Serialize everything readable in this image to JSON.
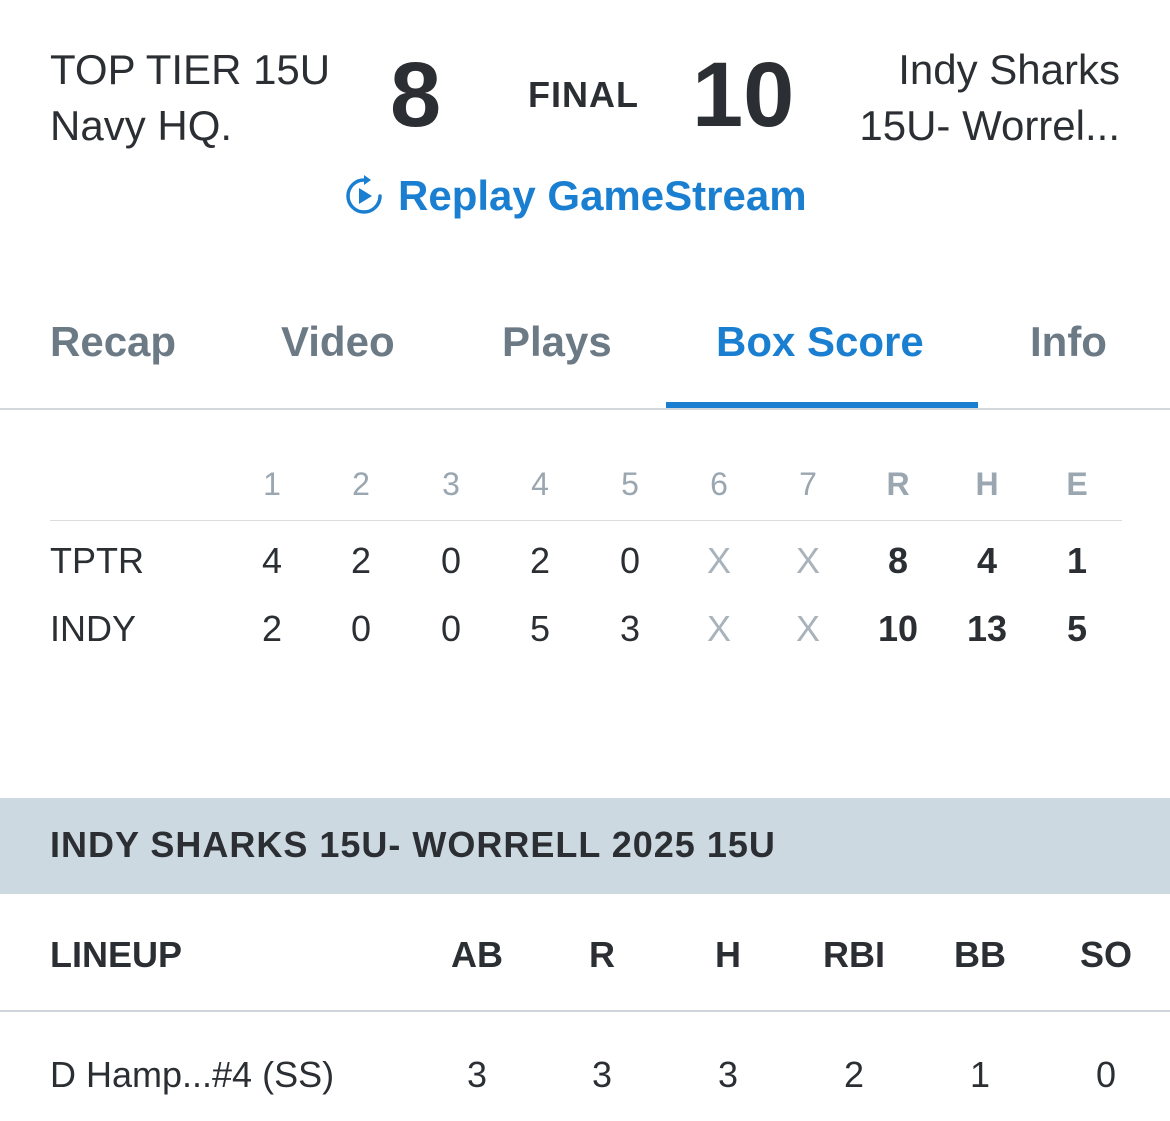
{
  "game": {
    "away_name_line1": "TOP TIER 15U",
    "away_name_line2": "Navy HQ.",
    "away_score": "8",
    "status": "FINAL",
    "home_score": "10",
    "home_name_line1": "Indy Sharks",
    "home_name_line2": "15U- Worrel...",
    "replay_label": "Replay GameStream"
  },
  "tabs": [
    "Recap",
    "Video",
    "Plays",
    "Box Score",
    "Info"
  ],
  "active_tab": "Box Score",
  "linescore": {
    "headers": [
      "1",
      "2",
      "3",
      "4",
      "5",
      "6",
      "7",
      "R",
      "H",
      "E"
    ],
    "rows": [
      {
        "team": "TPTR",
        "innings": [
          "4",
          "2",
          "0",
          "2",
          "0",
          "X",
          "X"
        ],
        "r": "8",
        "h": "4",
        "e": "1"
      },
      {
        "team": "INDY",
        "innings": [
          "2",
          "0",
          "0",
          "5",
          "3",
          "X",
          "X"
        ],
        "r": "10",
        "h": "13",
        "e": "5"
      }
    ]
  },
  "section": {
    "title": "INDY SHARKS 15U- WORRELL 2025 15U"
  },
  "stats": {
    "lineup_label": "LINEUP",
    "columns": [
      "AB",
      "R",
      "H",
      "RBI",
      "BB",
      "SO"
    ],
    "rows": [
      {
        "player": "D Hamp...#4 (SS)",
        "values": [
          "3",
          "3",
          "3",
          "2",
          "1",
          "0"
        ]
      }
    ]
  },
  "colors": {
    "accent": "#1a7fd1",
    "section_bg": "#cdd9e0",
    "muted": "#9aa6b0",
    "text": "#2b2f33"
  }
}
